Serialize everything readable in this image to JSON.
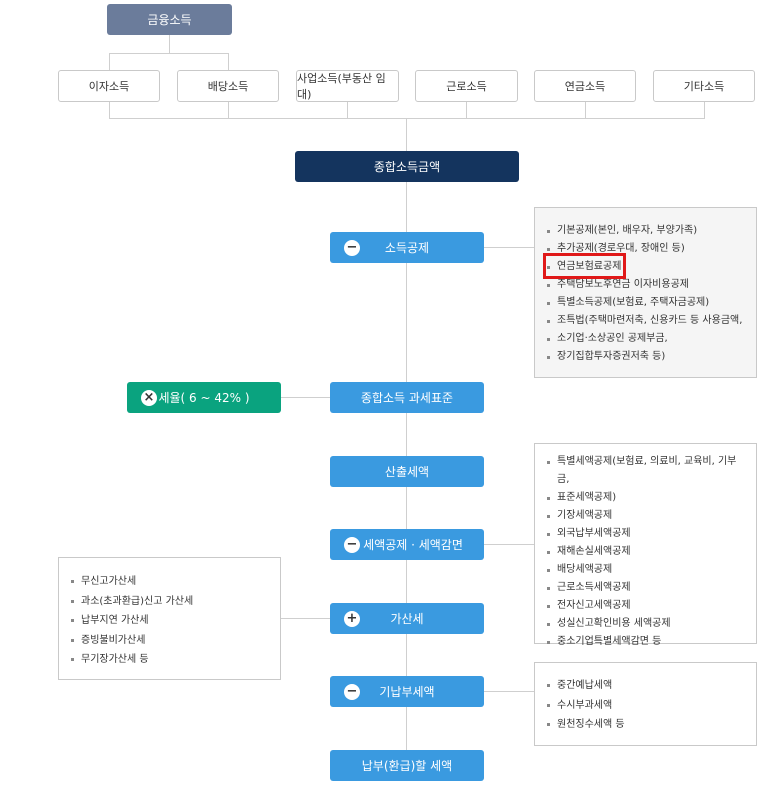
{
  "top": {
    "label": "금융소득"
  },
  "income_types": [
    "이자소득",
    "배당소득",
    "사업소득(부동산 임대)",
    "근로소득",
    "연금소득",
    "기타소득"
  ],
  "total_income": "종합소득금액",
  "steps": {
    "deduction": {
      "label": "소득공제",
      "sign": "−"
    },
    "tax_base": {
      "label": "종합소득 과세표준"
    },
    "calc_tax": {
      "label": "산출세액"
    },
    "credit": {
      "label": "세액공제 · 세액감면",
      "sign": "−"
    },
    "add_tax": {
      "label": "가산세",
      "sign": "+"
    },
    "prepaid": {
      "label": "기납부세액",
      "sign": "−"
    },
    "final": {
      "label": "납부(환급)할 세액"
    }
  },
  "tax_rate": {
    "label": "세율( 6 ~ 42% )",
    "sign": "×"
  },
  "deduction_box": [
    "기본공제(본인, 배우자, 부양가족)",
    "추가공제(경로우대, 장애인 등)",
    "연금보험료공제",
    "주택담보노후연금 이자비용공제",
    "특별소득공제(보험료, 주택자금공제)",
    "조특법(주택마련저축, 신용카드 등 사용금액,",
    "소기업·소상공인 공제부금,",
    "장기집합투자증권저축 등)"
  ],
  "credit_box": [
    "특별세액공제(보험료, 의료비, 교육비, 기부금,",
    "표준세액공제)",
    "기장세액공제",
    "외국납부세액공제",
    "재해손실세액공제",
    "배당세액공제",
    "근로소득세액공제",
    "전자신고세액공제",
    "성실신고확인비용 세액공제",
    "중소기업특별세액감면 등"
  ],
  "addtax_box": [
    "무신고가산세",
    "과소(초과환급)신고 가산세",
    "납부지연 가산세",
    "증빙불비가산세",
    "무기장가산세 등"
  ],
  "prepaid_box": [
    "중간예납세액",
    "수시부과세액",
    "원천징수세액 등"
  ],
  "colors": {
    "top": "#6b7c9b",
    "total": "#14345e",
    "step": "#3a9ae0",
    "green": "#0aa37f",
    "highlight": "#e01818"
  }
}
